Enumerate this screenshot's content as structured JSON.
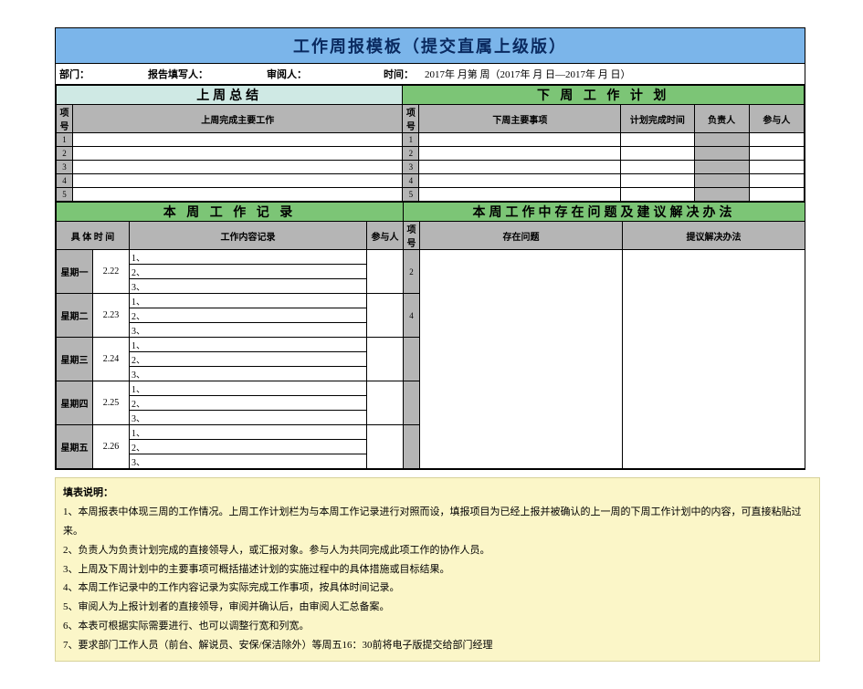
{
  "header": {
    "title": "工作周报模板（提交直属上级版）"
  },
  "info": {
    "dept_label": "部门：",
    "reporter_label": "报告填写人：",
    "reviewer_label": "审阅人：",
    "time_label": "时间：",
    "time_value": "2017年  月第  周（2017年  月  日—2017年  月  日）"
  },
  "sectionA": {
    "left_title": "上周总结",
    "right_title": "下 周 工 作 计 划",
    "seq_label": "项号",
    "left_col": "上周完成主要工作",
    "right_cols": {
      "item": "下周主要事项",
      "time": "计划完成时间",
      "owner": "负责人",
      "part": "参与人"
    },
    "rows": [
      "1",
      "2",
      "3",
      "4",
      "5"
    ]
  },
  "sectionB": {
    "left_title": "本 周 工 作 记 录",
    "right_title": "本周工作中存在问题及建议解决办法",
    "left_hdr": {
      "time": "具 体 时 间",
      "content": "工作内容记录",
      "part": "参与人"
    },
    "right_hdr": {
      "seq": "项号",
      "issue": "存在问题",
      "suggest": "提议解决办法"
    },
    "days": [
      {
        "day": "星期一",
        "date": "2.22",
        "lines": [
          "1、",
          "2、",
          "3、"
        ]
      },
      {
        "day": "星期二",
        "date": "2.23",
        "lines": [
          "1、",
          "2、",
          "3、"
        ]
      },
      {
        "day": "星期三",
        "date": "2.24",
        "lines": [
          "1、",
          "2、",
          "3、"
        ]
      },
      {
        "day": "星期四",
        "date": "2.25",
        "lines": [
          "1、",
          "2、",
          "3、"
        ]
      },
      {
        "day": "星期五",
        "date": "2.26",
        "lines": [
          "1、",
          "2、",
          "3、"
        ]
      }
    ],
    "right_seq": [
      "2",
      "",
      "4",
      "",
      "",
      "",
      "",
      "",
      "",
      "",
      "",
      "",
      "",
      "",
      ""
    ]
  },
  "notes": {
    "title": "填表说明：",
    "lines": [
      "1、本周报表中体现三周的工作情况。上周工作计划栏为与本周工作记录进行对照而设，填报项目为已经上报并被确认的上一周的下周工作计划中的内容，可直接粘贴过来。",
      "2、负责人为负责计划完成的直接领导人，或汇报对象。参与人为共同完成此项工作的协作人员。",
      "3、上周及下周计划中的主要事项可概括描述计划的实施过程中的具体措施或目标结果。",
      "4、本周工作记录中的工作内容记录为实际完成工作事项，按具体时间记录。",
      "5、审阅人为上报计划者的直接领导，审阅并确认后，由审阅人汇总备案。",
      "6、本表可根据实际需要进行、也可以调整行宽和列宽。",
      "7、要求部门工作人员（前台、解说员、安保/保洁除外）等周五16：30前将电子版提交给部门经理"
    ]
  }
}
